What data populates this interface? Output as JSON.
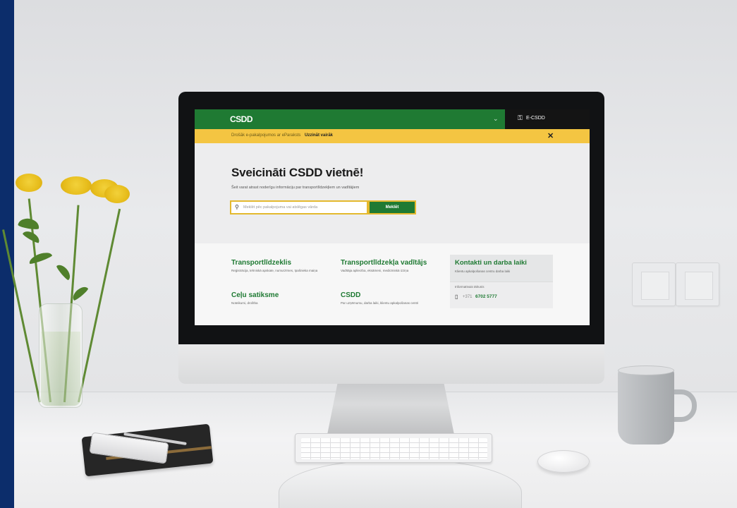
{
  "site": {
    "logo": "CSDD",
    "menu_chevron": "⌄",
    "eid_label": "E-CSDD",
    "notice": {
      "text": "Drošāk e-pakalpojumos ar eParaksts",
      "link": "Uzzināt vairāk",
      "close": "✕"
    },
    "hero": {
      "title": "Sveicināti CSDD vietnē!",
      "subtitle": "Šeit varat atrast noderīgu informāciju par transportlīdzekļiem un vadītājiem",
      "search_placeholder": "Meklēt pēc pakalpojuma vai atslēgas vārda",
      "search_button": "Meklēt"
    },
    "cards": [
      {
        "title": "Transportlīdzeklis",
        "desc": "Reģistrācija, tehniskā apskate, numurzīmes, īpašnieka maiņa"
      },
      {
        "title": "Transportlīdzekļa vadītājs",
        "desc": "Vadītāja apliecība, eksāmeni, medicīniskā izziņa"
      },
      {
        "title": "Ceļu satiksme",
        "desc": "Noteikumi, drošība"
      },
      {
        "title": "CSDD",
        "desc": "Par uzņēmumu, darba laiki, klientu apkalpošanas centri"
      }
    ],
    "contact": {
      "title": "Kontakti un darba laiki",
      "desc": "Klientu apkalpošanas centru darba laiki",
      "label": "Informatīvais tālrunis",
      "phone_prefix": "+371",
      "phone_number": "6702 5777"
    }
  },
  "scene": {
    "apple_logo": ""
  },
  "icons": [
    "search-icon",
    "phone-icon",
    "close-icon",
    "chevron-down-icon",
    "user-icon",
    "apple-logo-icon"
  ],
  "colors": {
    "brand_green": "#1f7a33",
    "notice_yellow": "#f4c542",
    "side_stripe": "#0c2d6b",
    "header_dark": "#141414"
  }
}
